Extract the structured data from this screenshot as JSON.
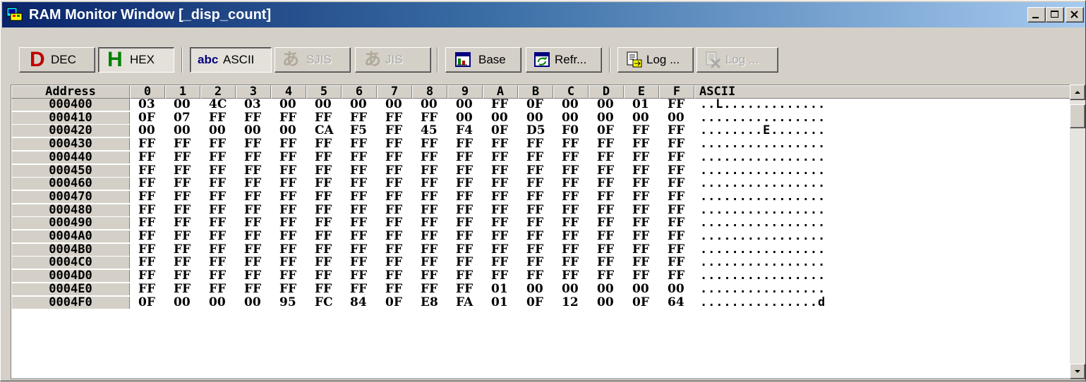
{
  "window": {
    "title": "RAM Monitor Window [_disp_count]",
    "controls": [
      "minimize",
      "maximize",
      "close"
    ]
  },
  "toolbar": {
    "dec_label": "DEC",
    "hex_label": "HEX",
    "ascii_label": "ASCII",
    "ascii_icon_text": "abc",
    "sjis_label": "SJIS",
    "jis_label": "JIS",
    "base_label": "Base",
    "refresh_label": "Refr...",
    "log_label": "Log ...",
    "log_disabled_label": "Log ...",
    "icons": {
      "dec": "D-letter-icon",
      "hex": "H-letter-icon",
      "sjis": "kana-a-icon",
      "jis": "kana-a-icon"
    },
    "colors": {
      "dec": "#c00000",
      "hex": "#008000",
      "ascii": "#00007f"
    }
  },
  "grid": {
    "address_header": "Address",
    "columns": [
      "0",
      "1",
      "2",
      "3",
      "4",
      "5",
      "6",
      "7",
      "8",
      "9",
      "A",
      "B",
      "C",
      "D",
      "E",
      "F"
    ],
    "ascii_header": "ASCII",
    "rows": [
      {
        "address": "000400",
        "cells": [
          "03",
          "00",
          "4C",
          "03",
          "00",
          "00",
          "00",
          "00",
          "00",
          "00",
          "FF",
          "0F",
          "00",
          "00",
          "01",
          "FF"
        ],
        "ascii": "..L............."
      },
      {
        "address": "000410",
        "cells": [
          "0F",
          "07",
          "FF",
          "FF",
          "FF",
          "FF",
          "FF",
          "FF",
          "FF",
          "00",
          "00",
          "00",
          "00",
          "00",
          "00",
          "00"
        ],
        "ascii": "................"
      },
      {
        "address": "000420",
        "cells": [
          "00",
          "00",
          "00",
          "00",
          "00",
          "CA",
          "F5",
          "FF",
          "45",
          "F4",
          "0F",
          "D5",
          "F0",
          "0F",
          "FF",
          "FF"
        ],
        "ascii": "........E......."
      },
      {
        "address": "000430",
        "cells": [
          "FF",
          "FF",
          "FF",
          "FF",
          "FF",
          "FF",
          "FF",
          "FF",
          "FF",
          "FF",
          "FF",
          "FF",
          "FF",
          "FF",
          "FF",
          "FF"
        ],
        "ascii": "................"
      },
      {
        "address": "000440",
        "cells": [
          "FF",
          "FF",
          "FF",
          "FF",
          "FF",
          "FF",
          "FF",
          "FF",
          "FF",
          "FF",
          "FF",
          "FF",
          "FF",
          "FF",
          "FF",
          "FF"
        ],
        "ascii": "................"
      },
      {
        "address": "000450",
        "cells": [
          "FF",
          "FF",
          "FF",
          "FF",
          "FF",
          "FF",
          "FF",
          "FF",
          "FF",
          "FF",
          "FF",
          "FF",
          "FF",
          "FF",
          "FF",
          "FF"
        ],
        "ascii": "................"
      },
      {
        "address": "000460",
        "cells": [
          "FF",
          "FF",
          "FF",
          "FF",
          "FF",
          "FF",
          "FF",
          "FF",
          "FF",
          "FF",
          "FF",
          "FF",
          "FF",
          "FF",
          "FF",
          "FF"
        ],
        "ascii": "................"
      },
      {
        "address": "000470",
        "cells": [
          "FF",
          "FF",
          "FF",
          "FF",
          "FF",
          "FF",
          "FF",
          "FF",
          "FF",
          "FF",
          "FF",
          "FF",
          "FF",
          "FF",
          "FF",
          "FF"
        ],
        "ascii": "................"
      },
      {
        "address": "000480",
        "cells": [
          "FF",
          "FF",
          "FF",
          "FF",
          "FF",
          "FF",
          "FF",
          "FF",
          "FF",
          "FF",
          "FF",
          "FF",
          "FF",
          "FF",
          "FF",
          "FF"
        ],
        "ascii": "................"
      },
      {
        "address": "000490",
        "cells": [
          "FF",
          "FF",
          "FF",
          "FF",
          "FF",
          "FF",
          "FF",
          "FF",
          "FF",
          "FF",
          "FF",
          "FF",
          "FF",
          "FF",
          "FF",
          "FF"
        ],
        "ascii": "................"
      },
      {
        "address": "0004A0",
        "cells": [
          "FF",
          "FF",
          "FF",
          "FF",
          "FF",
          "FF",
          "FF",
          "FF",
          "FF",
          "FF",
          "FF",
          "FF",
          "FF",
          "FF",
          "FF",
          "FF"
        ],
        "ascii": "................"
      },
      {
        "address": "0004B0",
        "cells": [
          "FF",
          "FF",
          "FF",
          "FF",
          "FF",
          "FF",
          "FF",
          "FF",
          "FF",
          "FF",
          "FF",
          "FF",
          "FF",
          "FF",
          "FF",
          "FF"
        ],
        "ascii": "................"
      },
      {
        "address": "0004C0",
        "cells": [
          "FF",
          "FF",
          "FF",
          "FF",
          "FF",
          "FF",
          "FF",
          "FF",
          "FF",
          "FF",
          "FF",
          "FF",
          "FF",
          "FF",
          "FF",
          "FF"
        ],
        "ascii": "................"
      },
      {
        "address": "0004D0",
        "cells": [
          "FF",
          "FF",
          "FF",
          "FF",
          "FF",
          "FF",
          "FF",
          "FF",
          "FF",
          "FF",
          "FF",
          "FF",
          "FF",
          "FF",
          "FF",
          "FF"
        ],
        "ascii": "................"
      },
      {
        "address": "0004E0",
        "cells": [
          "FF",
          "FF",
          "FF",
          "FF",
          "FF",
          "FF",
          "FF",
          "FF",
          "FF",
          "FF",
          "01",
          "00",
          "00",
          "00",
          "00",
          "00"
        ],
        "ascii": "................"
      },
      {
        "address": "0004F0",
        "cells": [
          "0F",
          "00",
          "00",
          "00",
          "95",
          "FC",
          "84",
          "0F",
          "E8",
          "FA",
          "01",
          "0F",
          "12",
          "00",
          "0F",
          "64"
        ],
        "ascii": "...............d"
      }
    ]
  }
}
